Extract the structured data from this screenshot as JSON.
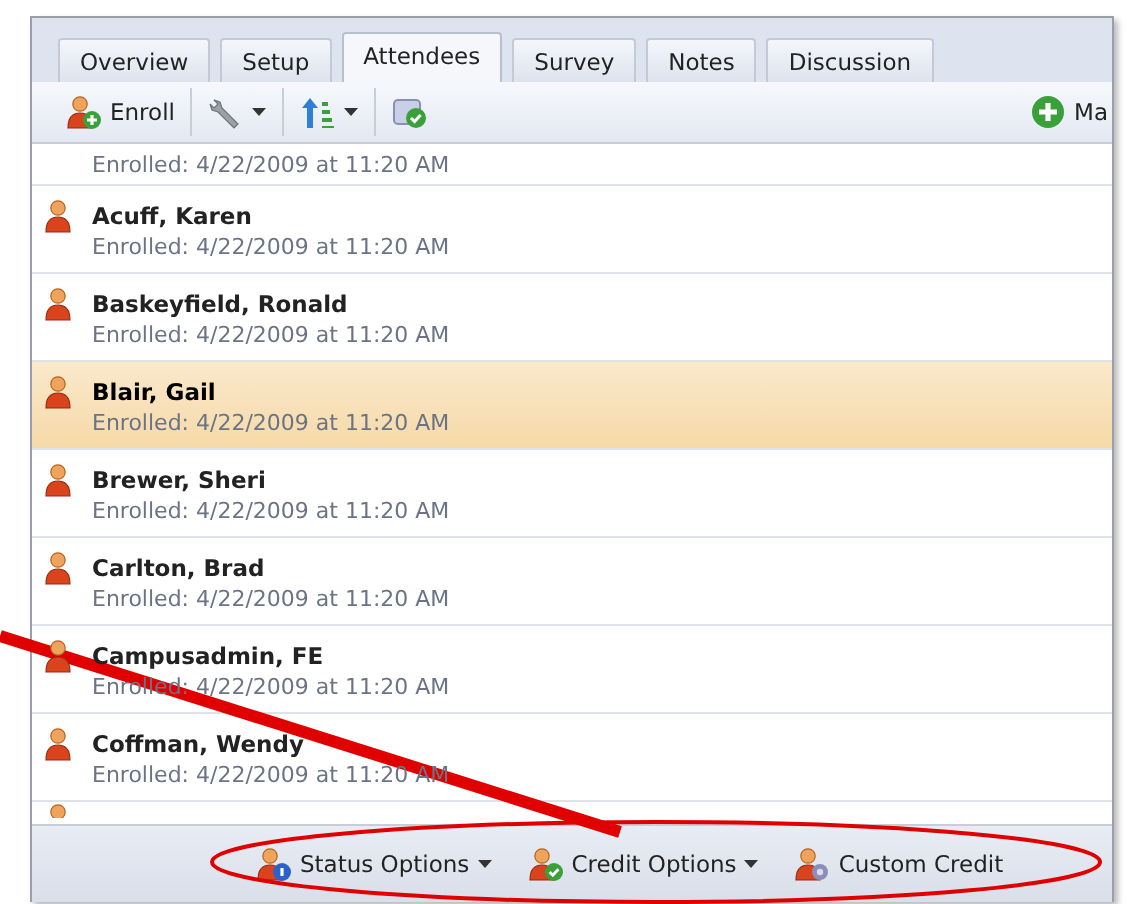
{
  "tabs": [
    {
      "label": "Overview",
      "selected": false
    },
    {
      "label": "Setup",
      "selected": false
    },
    {
      "label": "Attendees",
      "selected": true
    },
    {
      "label": "Survey",
      "selected": false
    },
    {
      "label": "Notes",
      "selected": false
    },
    {
      "label": "Discussion",
      "selected": false
    }
  ],
  "toolbar": {
    "enroll": "Enroll",
    "more": "Ma"
  },
  "attendees": [
    {
      "detail": "Enrolled: 4/22/2009 at 11:20 AM",
      "selected": false
    },
    {
      "name": "Acuff, Karen",
      "detail": "Enrolled: 4/22/2009 at 11:20 AM",
      "selected": false
    },
    {
      "name": "Baskeyfield, Ronald",
      "detail": "Enrolled: 4/22/2009 at 11:20 AM",
      "selected": false
    },
    {
      "name": "Blair, Gail",
      "detail": "Enrolled: 4/22/2009 at 11:20 AM",
      "selected": true
    },
    {
      "name": "Brewer, Sheri",
      "detail": "Enrolled: 4/22/2009 at 11:20 AM",
      "selected": false
    },
    {
      "name": "Carlton, Brad",
      "detail": "Enrolled: 4/22/2009 at 11:20 AM",
      "selected": false
    },
    {
      "name": "Campusadmin, FE",
      "detail": "Enrolled: 4/22/2009 at 11:20 AM",
      "selected": false
    },
    {
      "name": "Coffman, Wendy",
      "detail": "Enrolled: 4/22/2009 at 11:20 AM",
      "selected": false
    }
  ],
  "footer_buttons": [
    {
      "label": "Status Options",
      "dropdown": true
    },
    {
      "label": "Credit Options",
      "dropdown": true
    },
    {
      "label": "Custom Credit",
      "dropdown": false
    }
  ]
}
